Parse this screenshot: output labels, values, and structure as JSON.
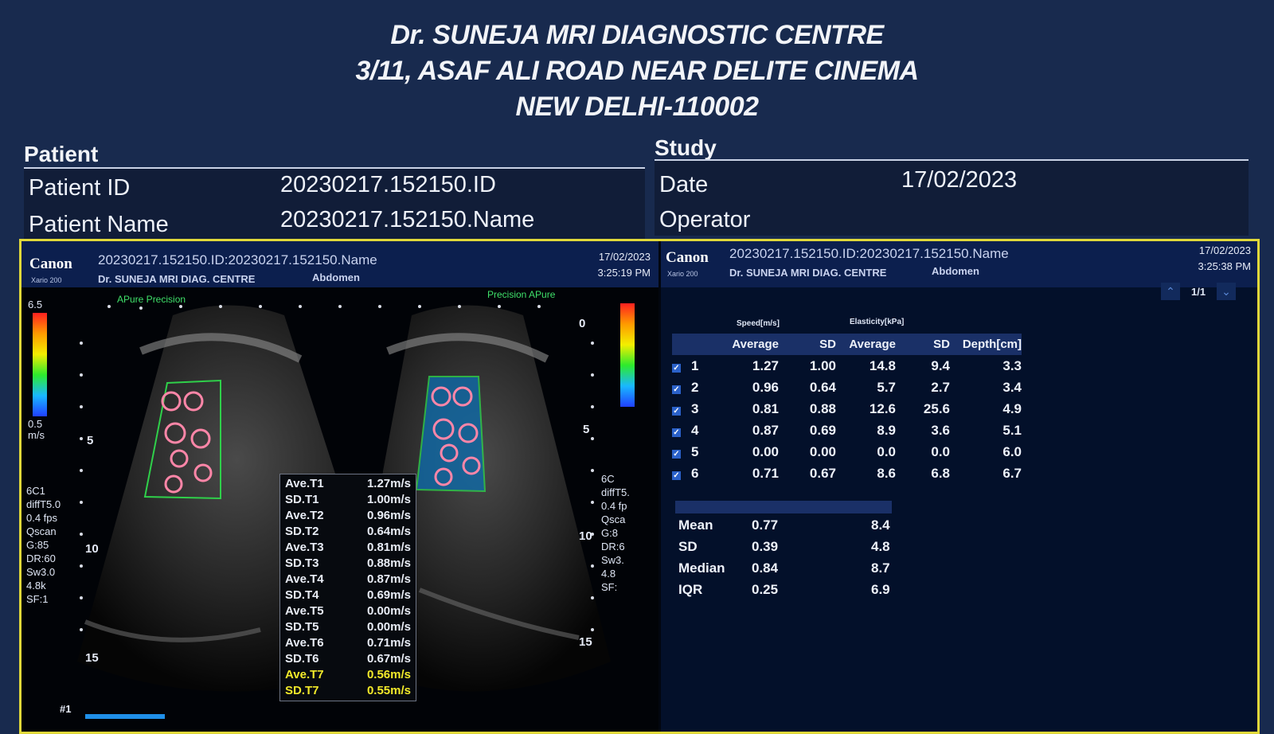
{
  "header": {
    "line1": "Dr. SUNEJA MRI  DIAGNOSTIC CENTRE",
    "line2": "3/11, ASAF ALI ROAD NEAR DELITE CINEMA",
    "line3": "NEW DELHI-110002"
  },
  "patient": {
    "title": "Patient",
    "id_label": "Patient ID",
    "id_value": "20230217.152150.ID",
    "name_label": "Patient Name",
    "name_value": "20230217.152150.Name"
  },
  "study": {
    "title": "Study",
    "date_label": "Date",
    "date_value": "17/02/2023",
    "operator_label": "Operator",
    "operator_value": ""
  },
  "left_panel": {
    "brand": "Canon",
    "model": "Xario 200",
    "id_line": "20230217.152150.ID:20230217.152150.Name",
    "centre": "Dr. SUNEJA MRI DIAG. CENTRE",
    "organ": "Abdomen",
    "date": "17/02/2023",
    "time": "3:25:19 PM",
    "scale_top": "6.5",
    "scale_bottom": "0.5",
    "scale_unit": "m/s",
    "mode_top_left": "APure Precision",
    "mode_top_right": "Precision  APure",
    "params_left": [
      "6C1",
      "diffT5.0",
      "0.4 fps",
      "Qscan",
      "G:85",
      "DR:60",
      "Sw3.0",
      "4.8k",
      "SF:1"
    ],
    "params_right": [
      "6C",
      "diffT5.",
      "0.4 fp",
      "Qsca",
      "G:8",
      "DR:6",
      "Sw3.",
      "4.8",
      "SF:"
    ],
    "depth_left": [
      "0",
      "5",
      "10",
      "15"
    ],
    "depth_right": [
      "0",
      "5",
      "10",
      "15"
    ],
    "frame": "#1",
    "measurements": [
      {
        "label": "Ave.T1",
        "value": "1.27m/s",
        "highlight": false
      },
      {
        "label": "SD.T1",
        "value": "1.00m/s",
        "highlight": false
      },
      {
        "label": "Ave.T2",
        "value": "0.96m/s",
        "highlight": false
      },
      {
        "label": "SD.T2",
        "value": "0.64m/s",
        "highlight": false
      },
      {
        "label": "Ave.T3",
        "value": "0.81m/s",
        "highlight": false
      },
      {
        "label": "SD.T3",
        "value": "0.88m/s",
        "highlight": false
      },
      {
        "label": "Ave.T4",
        "value": "0.87m/s",
        "highlight": false
      },
      {
        "label": "SD.T4",
        "value": "0.69m/s",
        "highlight": false
      },
      {
        "label": "Ave.T5",
        "value": "0.00m/s",
        "highlight": false
      },
      {
        "label": "SD.T5",
        "value": "0.00m/s",
        "highlight": false
      },
      {
        "label": "Ave.T6",
        "value": "0.71m/s",
        "highlight": false
      },
      {
        "label": "SD.T6",
        "value": "0.67m/s",
        "highlight": false
      },
      {
        "label": "Ave.T7",
        "value": "0.56m/s",
        "highlight": true
      },
      {
        "label": "SD.T7",
        "value": "0.55m/s",
        "highlight": true
      }
    ]
  },
  "right_panel": {
    "brand": "Canon",
    "model": "Xario 200",
    "id_line": "20230217.152150.ID:20230217.152150.Name",
    "centre": "Dr. SUNEJA MRI DIAG. CENTRE",
    "organ": "Abdomen",
    "date": "17/02/2023",
    "time": "3:25:38 PM",
    "page": "1/1",
    "group_speed": "Speed[m/s]",
    "group_elasticity": "Elasticity[kPa]",
    "columns": [
      "Average",
      "SD",
      "Average",
      "SD",
      "Depth[cm]"
    ],
    "rows": [
      {
        "n": "1",
        "speed_avg": "1.27",
        "speed_sd": "1.00",
        "el_avg": "14.8",
        "el_sd": "9.4",
        "depth": "3.3"
      },
      {
        "n": "2",
        "speed_avg": "0.96",
        "speed_sd": "0.64",
        "el_avg": "5.7",
        "el_sd": "2.7",
        "depth": "3.4"
      },
      {
        "n": "3",
        "speed_avg": "0.81",
        "speed_sd": "0.88",
        "el_avg": "12.6",
        "el_sd": "25.6",
        "depth": "4.9"
      },
      {
        "n": "4",
        "speed_avg": "0.87",
        "speed_sd": "0.69",
        "el_avg": "8.9",
        "el_sd": "3.6",
        "depth": "5.1"
      },
      {
        "n": "5",
        "speed_avg": "0.00",
        "speed_sd": "0.00",
        "el_avg": "0.0",
        "el_sd": "0.0",
        "depth": "6.0"
      },
      {
        "n": "6",
        "speed_avg": "0.71",
        "speed_sd": "0.67",
        "el_avg": "8.6",
        "el_sd": "6.8",
        "depth": "6.7"
      }
    ],
    "stats": [
      {
        "label": "Mean",
        "speed": "0.77",
        "elasticity": "8.4"
      },
      {
        "label": "SD",
        "speed": "0.39",
        "elasticity": "4.8"
      },
      {
        "label": "Median",
        "speed": "0.84",
        "elasticity": "8.7"
      },
      {
        "label": "IQR",
        "speed": "0.25",
        "elasticity": "6.9"
      }
    ]
  },
  "colors": {
    "frame": "#e0d83a",
    "highlight": "#f3ea2a",
    "roi_green": "#2fd04a",
    "roi_circle": "#ff86a8"
  }
}
